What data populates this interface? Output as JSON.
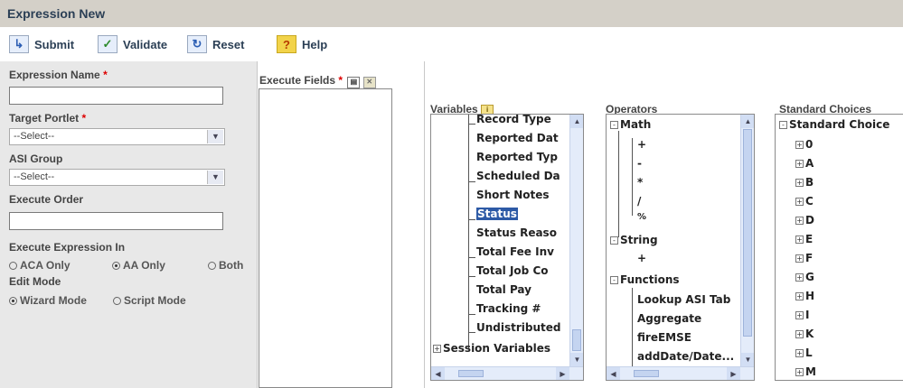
{
  "window": {
    "title": "Expression New"
  },
  "toolbar": {
    "submit_label": "Submit",
    "validate_label": "Validate",
    "reset_label": "Reset",
    "help_label": "Help"
  },
  "form": {
    "expression_name_label": "Expression Name",
    "required_mark": "*",
    "expression_name_value": "",
    "target_portlet_label": "Target Portlet",
    "target_portlet_value": "--Select--",
    "asi_group_label": "ASI Group",
    "asi_group_value": "--Select--",
    "execute_order_label": "Execute Order",
    "execute_order_value": "",
    "execute_in_label": "Execute Expression In",
    "execute_in_options": [
      "ACA Only",
      "AA Only",
      "Both"
    ],
    "execute_in_selected": "AA Only",
    "edit_mode_label": "Edit Mode",
    "edit_mode_options": [
      "Wizard Mode",
      "Script Mode"
    ],
    "edit_mode_selected": "Wizard Mode"
  },
  "execute_fields": {
    "label": "Execute Fields",
    "required_mark": "*"
  },
  "variables": {
    "label": "Variables",
    "items": [
      "Record Type",
      "Reported Dat",
      "Reported Typ",
      "Scheduled Da",
      "Short Notes",
      "Status",
      "Status Reaso",
      "Total Fee Inv",
      "Total Job Co",
      "Total Pay",
      "Tracking #",
      "Undistributed"
    ],
    "selected": "Status",
    "session_label": "Session Variables"
  },
  "operators": {
    "label": "Operators",
    "math_label": "Math",
    "math_items": [
      "+",
      "-",
      "*",
      "/",
      "%"
    ],
    "string_label": "String",
    "string_items": [
      "+"
    ],
    "functions_label": "Functions",
    "function_items": [
      "Lookup ASI Tab",
      "Aggregate",
      "fireEMSE",
      "addDate/Date..."
    ]
  },
  "standard_choices": {
    "label": "Standard Choices",
    "root_label": "Standard Choice",
    "items": [
      "0",
      "A",
      "B",
      "C",
      "D",
      "E",
      "F",
      "G",
      "H",
      "I",
      "K",
      "L",
      "M"
    ]
  },
  "icons": [
    "submit-icon",
    "validate-icon",
    "reset-icon",
    "help-icon",
    "field-add-icon",
    "field-delete-icon",
    "variables-info-icon"
  ]
}
